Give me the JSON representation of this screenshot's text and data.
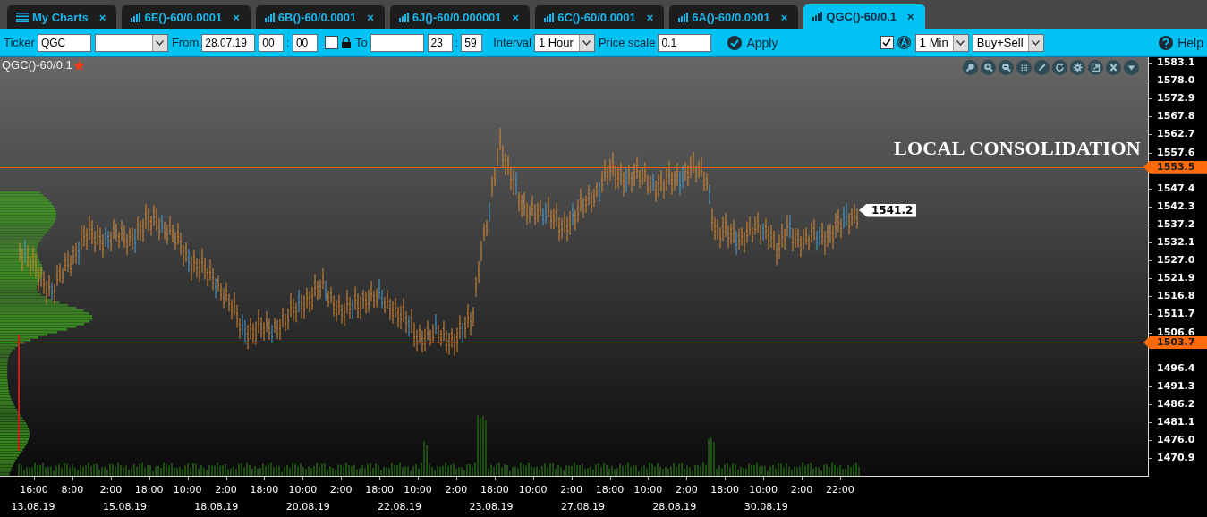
{
  "tabs": [
    {
      "kind": "menu",
      "label": "My Charts",
      "close": "×",
      "selected": false
    },
    {
      "kind": "chart",
      "label": "6E()-60/0.0001",
      "close": "×",
      "selected": false
    },
    {
      "kind": "chart",
      "label": "6B()-60/0.0001",
      "close": "×",
      "selected": false
    },
    {
      "kind": "chart",
      "label": "6J()-60/0.000001",
      "close": "×",
      "selected": false
    },
    {
      "kind": "chart",
      "label": "6C()-60/0.0001",
      "close": "×",
      "selected": false
    },
    {
      "kind": "chart",
      "label": "6A()-60/0.0001",
      "close": "×",
      "selected": false
    },
    {
      "kind": "chart",
      "label": "QGC()-60/0.1",
      "close": "×",
      "selected": true
    }
  ],
  "toolbar": {
    "ticker": {
      "label": "Ticker",
      "value": "QGC"
    },
    "from": {
      "label": "From",
      "date": "28.07.19",
      "hour": "00",
      "separator": ":",
      "minute": "00"
    },
    "to": {
      "checked": false,
      "label": "To",
      "hour": "23",
      "separator": ":",
      "minute": "59"
    },
    "interval": {
      "label": "Interval",
      "value": "1 Hour"
    },
    "price_scale": {
      "label": "Price scale",
      "value": "0.1"
    },
    "apply": "Apply",
    "auto": {
      "checked": true
    },
    "timeframe": "1 Min",
    "side": "Buy+Sell",
    "help": "Help"
  },
  "chart": {
    "title": "QGC()-60/0.1",
    "annotation": "LOCAL CONSOLIDATION",
    "levels": [
      {
        "label": "1553.5"
      },
      {
        "label": "1503.7"
      }
    ],
    "last_price": "1541.2",
    "price_ticks": [
      "1583.1",
      "1578.0",
      "1572.9",
      "1567.8",
      "1562.7",
      "1557.6",
      "1547.4",
      "1542.3",
      "1537.2",
      "1532.1",
      "1527.0",
      "1521.9",
      "1516.8",
      "1511.7",
      "1506.6",
      "1496.4",
      "1491.3",
      "1486.2",
      "1481.1",
      "1476.0",
      "1470.9"
    ],
    "time_ticks": [
      "16:00",
      "8:00",
      "2:00",
      "18:00",
      "10:00",
      "2:00",
      "18:00",
      "10:00",
      "2:00",
      "18:00",
      "10:00",
      "2:00",
      "18:00",
      "10:00",
      "2:00",
      "18:00",
      "10:00",
      "2:00",
      "18:00",
      "10:00",
      "2:00",
      "22:00"
    ],
    "date_ticks": [
      "13.08.19",
      "15.08.19",
      "18.08.19",
      "20.08.19",
      "22.08.19",
      "23.08.19",
      "27.08.19",
      "28.08.19",
      "30.08.19"
    ]
  }
}
